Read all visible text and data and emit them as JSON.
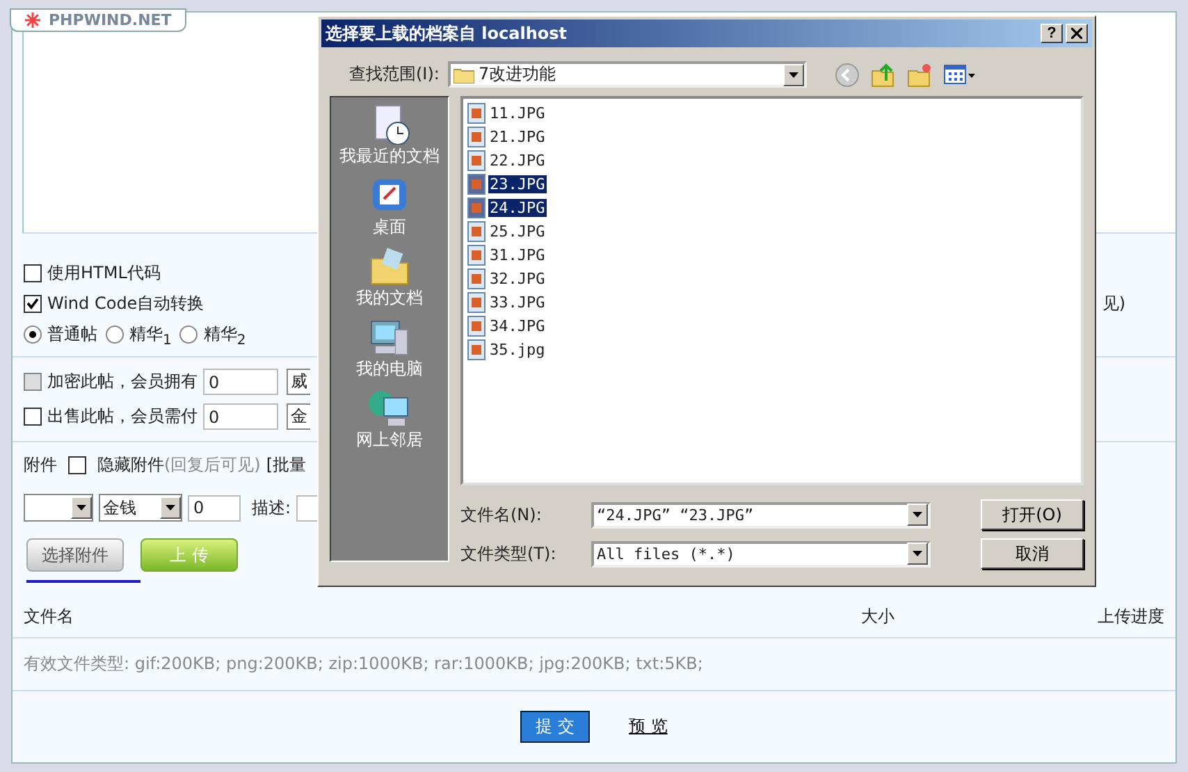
{
  "logo": {
    "text": "PHPWIND.NET"
  },
  "options": [
    {
      "label": "使用HTML代码",
      "checked": false
    },
    {
      "label": "Wind Code自动转换",
      "checked": true,
      "note": "见)"
    }
  ],
  "post_types": [
    {
      "label": "普通帖",
      "selected": true
    },
    {
      "label": "精华$_{1}$",
      "selected": false
    },
    {
      "label": "精华$_{2}$",
      "selected": false
    }
  ],
  "sale_rows": [
    {
      "label": "加密此帖，会员拥有",
      "checked": false,
      "disabled": true,
      "value": "0",
      "unit": "威"
    },
    {
      "label": "出售此帖，会员需付",
      "checked": false,
      "disabled": false,
      "value": "0",
      "unit": "金"
    }
  ],
  "attachment": {
    "label": "附件",
    "hide_checked": false,
    "hide_label": "隐藏附件",
    "hide_note": "(回复后可见)",
    "batch": "[批量"
  },
  "attach_row": {
    "currency": "金钱",
    "price": "0",
    "desc_label": "描述:"
  },
  "attach_buttons": [
    {
      "label": "选择附件",
      "kind": "plain"
    },
    {
      "label": "上 传",
      "kind": "green"
    }
  ],
  "table": {
    "columns": [
      "文件名",
      "大小",
      "上传进度"
    ],
    "note": "有效文件类型: gif:200KB; png:200KB; zip:1000KB; rar:1000KB; jpg:200KB; txt:5KB;"
  },
  "actions": [
    {
      "label": "提 交",
      "kind": "primary"
    },
    {
      "label": "预 览",
      "kind": "link"
    }
  ],
  "dialog": {
    "title": "选择要上载的档案自 localhost",
    "help": "?",
    "look_in_label": "查找范围(I):",
    "look_in": "7改进功能",
    "places": [
      {
        "label": "我最近的文档",
        "kind": "recent"
      },
      {
        "label": "桌面",
        "kind": "desktop"
      },
      {
        "label": "我的文档",
        "kind": "documents"
      },
      {
        "label": "我的电脑",
        "kind": "computer"
      },
      {
        "label": "网上邻居",
        "kind": "network"
      }
    ],
    "files": [
      {
        "name": "11.JPG",
        "selected": false
      },
      {
        "name": "21.JPG",
        "selected": false
      },
      {
        "name": "22.JPG",
        "selected": false
      },
      {
        "name": "23.JPG",
        "selected": true
      },
      {
        "name": "24.JPG",
        "selected": true
      },
      {
        "name": "25.JPG",
        "selected": false
      },
      {
        "name": "31.JPG",
        "selected": false
      },
      {
        "name": "32.JPG",
        "selected": false
      },
      {
        "name": "33.JPG",
        "selected": false
      },
      {
        "name": "34.JPG",
        "selected": false
      },
      {
        "name": "35.jpg",
        "selected": false
      }
    ],
    "filename_label": "文件名(N):",
    "filename": "“24.JPG” “23.JPG”",
    "filetype_label": "文件类型(T):",
    "filetype": "All files (*.*)",
    "buttons": [
      "打开(O)",
      "取消"
    ]
  }
}
